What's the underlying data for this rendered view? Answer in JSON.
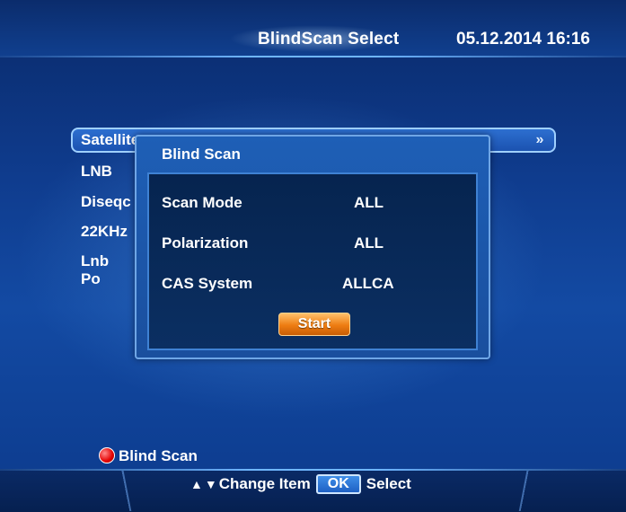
{
  "header": {
    "title": "BlindScan Select",
    "datetime": "05.12.2014  16:16"
  },
  "menu": {
    "items": [
      {
        "label": "Satellite"
      },
      {
        "label": "LNB"
      },
      {
        "label": "Diseqc"
      },
      {
        "label": "22KHz"
      },
      {
        "label": "Lnb Po"
      }
    ],
    "arrow_icon": "double-chevron-right-icon"
  },
  "dialog": {
    "title": "Blind Scan",
    "options": [
      {
        "label": "Scan Mode",
        "value": "ALL"
      },
      {
        "label": "Polarization",
        "value": "ALL"
      },
      {
        "label": "CAS System",
        "value": "ALLCA"
      }
    ],
    "start_label": "Start"
  },
  "hint": {
    "icon": "red-button-icon",
    "label": "Blind Scan"
  },
  "footer": {
    "up_icon": "▲",
    "down_icon": "▼",
    "change_label": "Change Item",
    "ok_key": "OK",
    "select_label": "Select"
  },
  "colors": {
    "background": "#134aa3",
    "dialog_inner": "#06244f",
    "accent_button": "#ee7d12",
    "red_key": "#e50000"
  }
}
